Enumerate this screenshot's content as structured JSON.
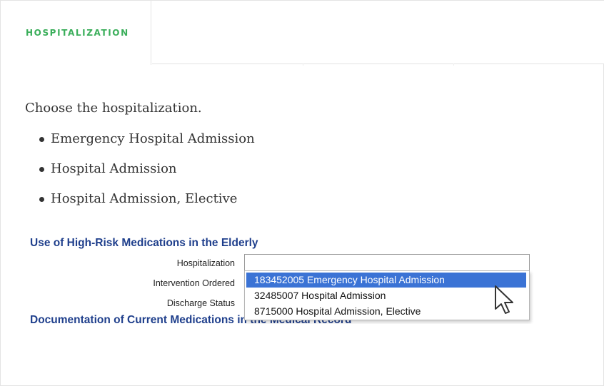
{
  "tabs": {
    "active_label": "HOSPITALIZATION"
  },
  "content": {
    "intro": "Choose the hospitalization.",
    "options": [
      "Emergency Hospital Admission",
      "Hospital Admission",
      "Hospital Admission, Elective"
    ]
  },
  "screenshot": {
    "title": "Use of High-Risk Medications in the Elderly",
    "labels": [
      "Hospitalization",
      "Intervention Ordered",
      "Discharge Status"
    ],
    "select_value": "",
    "dropdown_items": [
      "183452005 Emergency Hospital Admission",
      "32485007 Hospital Admission",
      "8715000 Hospital Admission, Elective"
    ],
    "selected_index": 0,
    "footer_title": "Documentation of Current Medications in the Medical Record"
  },
  "colors": {
    "tab_accent": "#3aae5a",
    "heading_blue": "#1f3f8c",
    "selection_blue": "#3b73d5"
  },
  "icons": [
    "bullet-icon",
    "mouse-pointer-icon"
  ]
}
